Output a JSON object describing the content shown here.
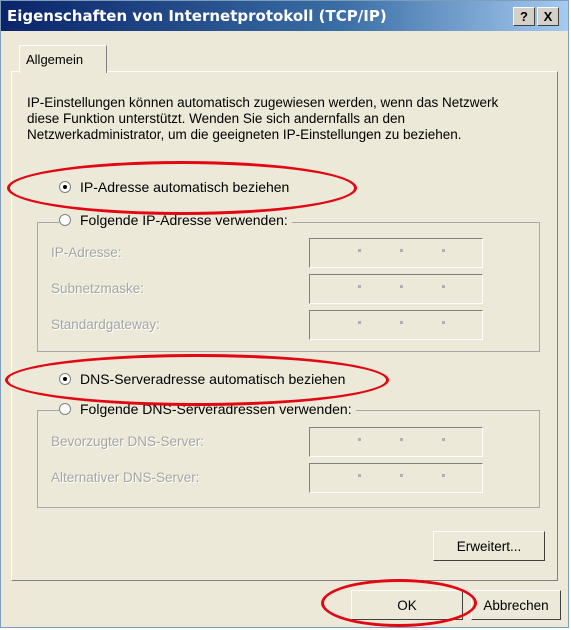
{
  "window": {
    "title": "Eigenschaften von Internetprotokoll (TCP/IP)",
    "help_label": "?",
    "close_label": "X"
  },
  "tabs": [
    {
      "label": "Allgemein"
    }
  ],
  "description": "IP-Einstellungen können automatisch zugewiesen werden, wenn das Netzwerk diese Funktion unterstützt. Wenden Sie sich andernfalls an den Netzwerkadministrator, um die geeigneten IP-Einstellungen zu beziehen.",
  "ip": {
    "auto_label": "IP-Adresse automatisch beziehen",
    "manual_label": "Folgende IP-Adresse verwenden:",
    "selected": "auto",
    "fields": [
      {
        "label": "IP-Adresse:"
      },
      {
        "label": "Subnetzmaske:"
      },
      {
        "label": "Standardgateway:"
      }
    ]
  },
  "dns": {
    "auto_label": "DNS-Serveradresse automatisch beziehen",
    "manual_label": "Folgende DNS-Serveradressen verwenden:",
    "selected": "auto",
    "fields": [
      {
        "label": "Bevorzugter DNS-Server:"
      },
      {
        "label": "Alternativer DNS-Server:"
      }
    ]
  },
  "buttons": {
    "advanced": "Erweitert...",
    "ok": "OK",
    "cancel": "Abbrechen"
  },
  "annotation_color": "#e30613"
}
